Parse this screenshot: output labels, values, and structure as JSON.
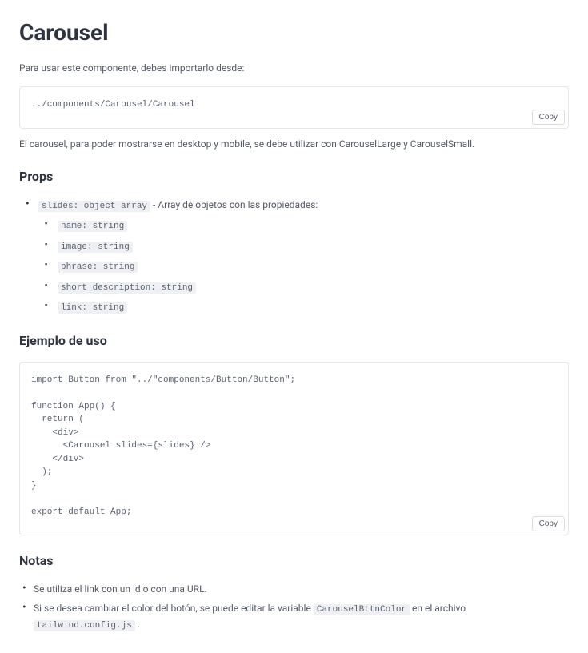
{
  "title": "Carousel",
  "intro": "Para usar este componente, debes importarlo desde:",
  "import_code": "../components/Carousel/Carousel",
  "copy_label": "Copy",
  "description": "El carousel, para poder mostrarse en desktop y mobile, se debe utilizar con CarouselLarge y CarouselSmall.",
  "sections": {
    "props": "Props",
    "example": "Ejemplo de uso",
    "notes": "Notas"
  },
  "props_item": {
    "code": "slides: object array",
    "desc": " - Array de objetos con las propiedades:",
    "subs": [
      "name: string",
      "image: string",
      "phrase: string",
      "short_description: string",
      "link: string"
    ]
  },
  "example_code": "import Button from \"../\"components/Button/Button\";\n\nfunction App() {\n  return (\n    <div>\n      <Carousel slides={slides} />\n    </div>\n  );\n}\n\nexport default App;",
  "notes": {
    "n1": "Se utiliza el link con un id o con una URL.",
    "n2_a": "Si se desea cambiar el color del botón, se puede editar la variable ",
    "n2_code1": "CarouselBttnColor",
    "n2_b": " en el archivo ",
    "n2_code2": "tailwind.config.js",
    "n2_c": " ."
  }
}
